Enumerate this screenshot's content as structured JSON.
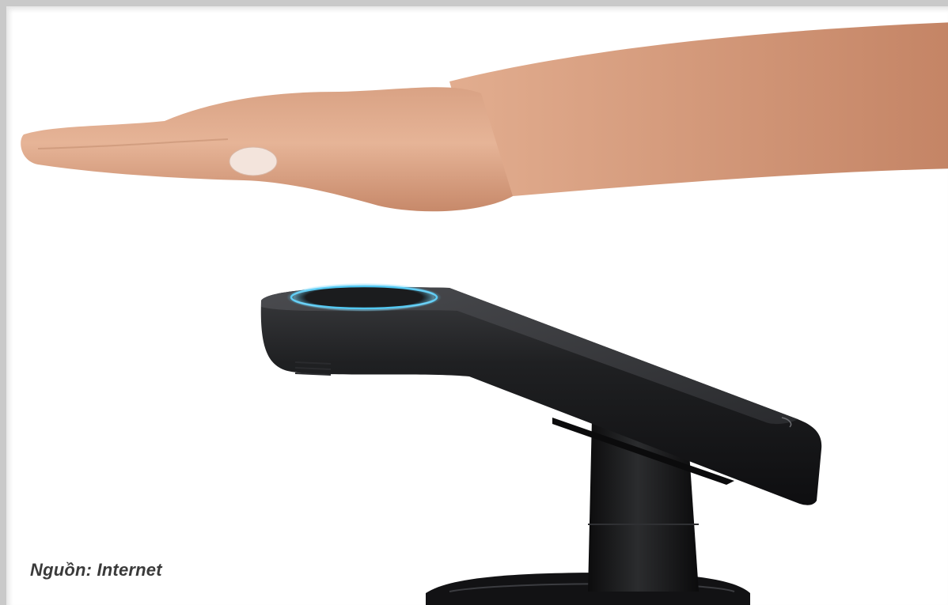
{
  "caption": "Nguồn: Internet",
  "image": {
    "subject": "palm-hovering-over-palm-scanner-device",
    "scanner_ring_color": "#4fc6f0",
    "device_color": "#1c1d1f",
    "skin_color": "#e1a986",
    "background_color": "#ffffff",
    "border_color": "#c9c9c9"
  }
}
